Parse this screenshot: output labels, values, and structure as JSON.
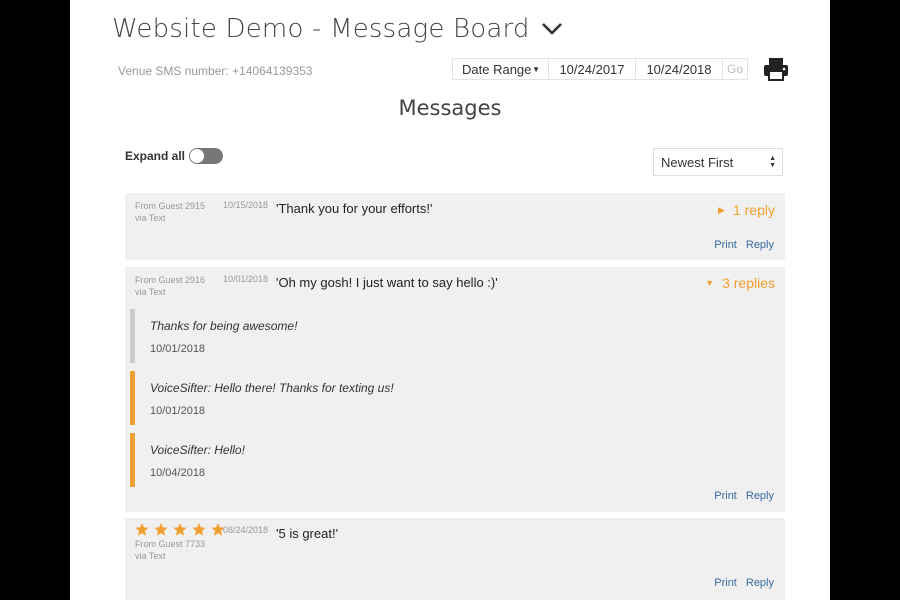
{
  "header": {
    "title": "Website Demo - Message Board",
    "venue_sms": "Venue SMS number: +14064139353"
  },
  "filters": {
    "date_range_label": "Date Range",
    "start_date": "10/24/2017",
    "end_date": "10/24/2018",
    "go_label": "Go"
  },
  "page_heading": "Messages",
  "controls": {
    "expand_all_label": "Expand all",
    "expand_all_on": false,
    "sort_selected": "Newest First"
  },
  "messages": [
    {
      "from": "From Guest 2915",
      "via": "via Text",
      "date": "10/15/2018",
      "text": "'Thank you for your efforts!'",
      "replies_label": "1 reply",
      "expanded": false,
      "print_label": "Print",
      "reply_label": "Reply"
    },
    {
      "from": "From Guest 2916",
      "via": "via Text",
      "date": "10/01/2018",
      "text": "'Oh my gosh! I just want to say hello :)'",
      "replies_label": "3 replies",
      "expanded": true,
      "replies": [
        {
          "text": "Thanks for being awesome!",
          "date": "10/01/2018",
          "bar_color": "#cccccc"
        },
        {
          "text": "VoiceSifter: Hello there! Thanks for texting us!",
          "date": "10/01/2018",
          "bar_color": "#f0a030"
        },
        {
          "text": "VoiceSifter: Hello!",
          "date": "10/04/2018",
          "bar_color": "#f0a030"
        }
      ],
      "print_label": "Print",
      "reply_label": "Reply"
    },
    {
      "rating": 5,
      "from": "From Guest 7733",
      "via": "via Text",
      "date": "08/24/2018",
      "text": "'5 is great!'",
      "print_label": "Print",
      "reply_label": "Reply"
    }
  ],
  "colors": {
    "accent": "#f0a030",
    "link": "#3a6aa0",
    "card_bg": "#f0f0f0",
    "toggle_off": "#777777"
  },
  "icons": {
    "title_dropdown": "chevron-down-icon",
    "print": "printer-icon",
    "rating": "star-icon"
  }
}
